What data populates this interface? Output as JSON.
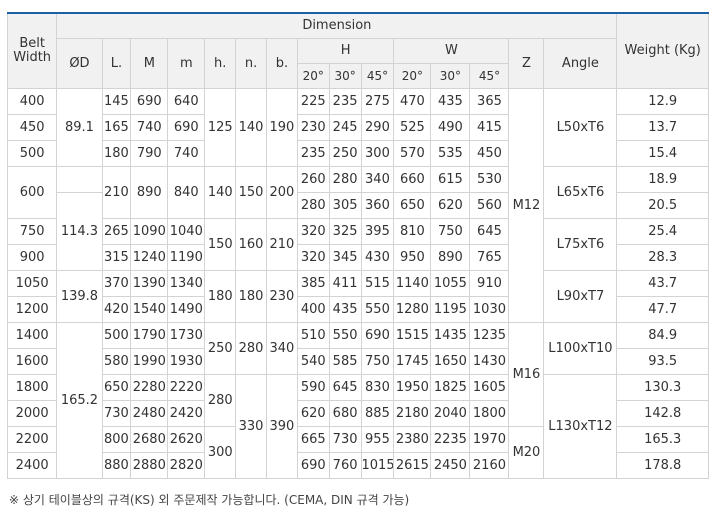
{
  "header": {
    "belt_width": "Belt\nWidth",
    "dimension": "Dimension",
    "weight": "Weight (Kg)",
    "od": "ØD",
    "l": "L.",
    "M": "M",
    "m": "m",
    "h_small": "h.",
    "n": "n.",
    "b": "b.",
    "H": "H",
    "W": "W",
    "Z": "Z",
    "angle": "Angle",
    "deg20": "20°",
    "deg30": "30°",
    "deg45": "45°"
  },
  "rows": [
    {
      "bw": "400",
      "od": "89.1",
      "l": "145",
      "M": "690",
      "m": "640",
      "h": "125",
      "n": "140",
      "b": "190",
      "H20": "225",
      "H30": "235",
      "H45": "275",
      "W20": "470",
      "W30": "435",
      "W45": "365",
      "z": "M12",
      "angle": "L50xT6",
      "weight": "12.9"
    },
    {
      "bw": "450",
      "l": "165",
      "M": "740",
      "m": "690",
      "H20": "230",
      "H30": "245",
      "H45": "290",
      "W20": "525",
      "W30": "490",
      "W45": "415",
      "weight": "13.7"
    },
    {
      "bw": "500",
      "l": "180",
      "M": "790",
      "m": "740",
      "H20": "235",
      "H30": "250",
      "H45": "300",
      "W20": "570",
      "W30": "535",
      "W45": "450",
      "weight": "15.4"
    },
    {
      "bw": "600",
      "l": "210",
      "M": "890",
      "m": "840",
      "h": "140",
      "n": "150",
      "b": "200",
      "H20": "260",
      "H30": "280",
      "H45": "340",
      "W20": "660",
      "W30": "615",
      "W45": "530",
      "angle": "L65xT6",
      "weight": "18.9"
    },
    {
      "od": "114.3",
      "H20": "280",
      "H30": "305",
      "H45": "360",
      "W20": "650",
      "W30": "620",
      "W45": "560",
      "weight": "20.5"
    },
    {
      "bw": "750",
      "l": "265",
      "M": "1090",
      "m": "1040",
      "h": "150",
      "n": "160",
      "b": "210",
      "H20": "320",
      "H30": "325",
      "H45": "395",
      "W20": "810",
      "W30": "750",
      "W45": "645",
      "angle": "L75xT6",
      "weight": "25.4"
    },
    {
      "bw": "900",
      "l": "315",
      "M": "1240",
      "m": "1190",
      "H20": "320",
      "H30": "345",
      "H45": "430",
      "W20": "950",
      "W30": "890",
      "W45": "765",
      "weight": "28.3"
    },
    {
      "bw": "1050",
      "od": "139.8",
      "l": "370",
      "M": "1390",
      "m": "1340",
      "h": "180",
      "n": "180",
      "b": "230",
      "H20": "385",
      "H30": "411",
      "H45": "515",
      "W20": "1140",
      "W30": "1055",
      "W45": "910",
      "angle": "L90xT7",
      "weight": "43.7"
    },
    {
      "bw": "1200",
      "l": "420",
      "M": "1540",
      "m": "1490",
      "H20": "400",
      "H30": "435",
      "H45": "550",
      "W20": "1280",
      "W30": "1195",
      "W45": "1030",
      "weight": "47.7"
    },
    {
      "bw": "1400",
      "od": "165.2",
      "l": "500",
      "M": "1790",
      "m": "1730",
      "h": "250",
      "n": "280",
      "b": "340",
      "H20": "510",
      "H30": "550",
      "H45": "690",
      "W20": "1515",
      "W30": "1435",
      "W45": "1235",
      "z": "M16",
      "angle": "L100xT10",
      "weight": "84.9"
    },
    {
      "bw": "1600",
      "l": "580",
      "M": "1990",
      "m": "1930",
      "H20": "540",
      "H30": "585",
      "H45": "750",
      "W20": "1745",
      "W30": "1650",
      "W45": "1430",
      "weight": "93.5"
    },
    {
      "bw": "1800",
      "l": "650",
      "M": "2280",
      "m": "2220",
      "h": "280",
      "n": "330",
      "b": "390",
      "H20": "590",
      "H30": "645",
      "H45": "830",
      "W20": "1950",
      "W30": "1825",
      "W45": "1605",
      "angle": "L130xT12",
      "weight": "130.3"
    },
    {
      "bw": "2000",
      "l": "730",
      "M": "2480",
      "m": "2420",
      "H20": "620",
      "H30": "680",
      "H45": "885",
      "W20": "2180",
      "W30": "2040",
      "W45": "1800",
      "weight": "142.8"
    },
    {
      "bw": "2200",
      "l": "800",
      "M": "2680",
      "m": "2620",
      "h": "300",
      "H20": "665",
      "H30": "730",
      "H45": "955",
      "W20": "2380",
      "W30": "2235",
      "W45": "1970",
      "z": "M20",
      "weight": "165.3"
    },
    {
      "bw": "2400",
      "l": "880",
      "M": "2880",
      "m": "2820",
      "H20": "690",
      "H30": "760",
      "H45": "1015",
      "W20": "2615",
      "W30": "2450",
      "W45": "2160",
      "weight": "178.8"
    }
  ],
  "note": "※ 상기 테이블상의 규격(KS) 외 주문제작 가능합니다. (CEMA, DIN 규격 가능)",
  "colors": {
    "accent_line": "#1b5fa6",
    "header_bg": "#f1f1f1",
    "border": "#d3d3d3",
    "text": "#333333"
  }
}
